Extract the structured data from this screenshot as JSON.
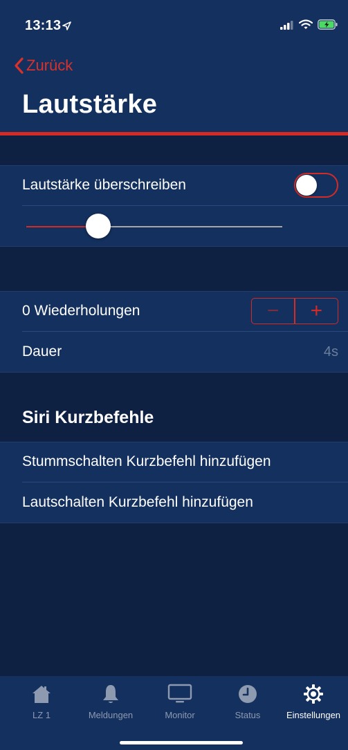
{
  "status_bar": {
    "time": "13:13"
  },
  "nav": {
    "back_label": "Zurück",
    "title": "Lautstärke"
  },
  "volume_group": {
    "override_label": "Lautstärke überschreiben",
    "override_enabled": false,
    "slider_value": 0.28
  },
  "repeat_group": {
    "repetitions_label": "0 Wiederholungen",
    "stepper_minus": "−",
    "stepper_plus": "+",
    "duration_label": "Dauer",
    "duration_value": "4s"
  },
  "siri_section": {
    "title": "Siri Kurzbefehle",
    "items": [
      {
        "label": "Stummschalten Kurzbefehl hinzufügen"
      },
      {
        "label": "Lautschalten Kurzbefehl hinzufügen"
      }
    ]
  },
  "tabbar": {
    "tabs": [
      {
        "label": "LZ 1",
        "icon": "house-icon",
        "active": false
      },
      {
        "label": "Meldungen",
        "icon": "bell-icon",
        "active": false
      },
      {
        "label": "Monitor",
        "icon": "monitor-icon",
        "active": false
      },
      {
        "label": "Status",
        "icon": "clock-icon",
        "active": false
      },
      {
        "label": "Einstellungen",
        "icon": "gear-icon",
        "active": true
      }
    ]
  },
  "colors": {
    "background": "#0f2142",
    "surface": "#14305e",
    "accent": "#d52b25",
    "secondary_text": "#6b7f9c"
  }
}
